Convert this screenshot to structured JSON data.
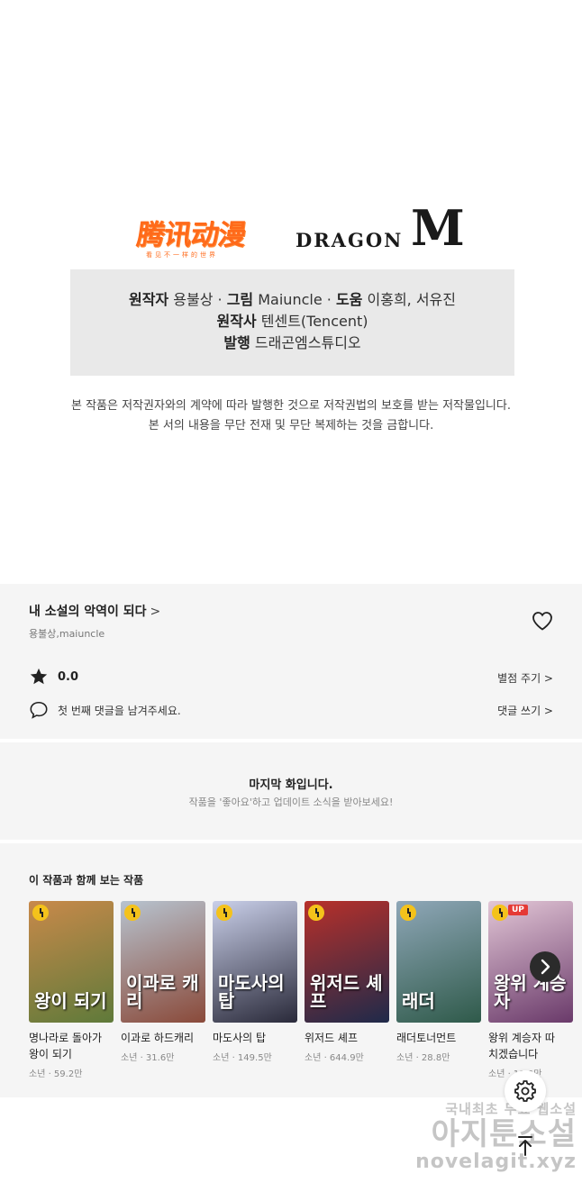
{
  "logos": {
    "tencent_name": "腾讯动漫",
    "tencent_tagline": "看见不一样的世界",
    "dragon_word": "DRAGON",
    "dragon_m": "M"
  },
  "credits": {
    "line1": [
      {
        "label": "원작자",
        "value": "용불상"
      },
      {
        "label": "그림",
        "value": "Maiuncle"
      },
      {
        "label": "도움",
        "value": "이홍희, 서유진"
      }
    ],
    "line2": {
      "label": "원작사",
      "value": "텐센트(Tencent)"
    },
    "line3": {
      "label": "발행",
      "value": "드래곤엠스튜디오"
    },
    "separator": "·"
  },
  "notice": {
    "line1": "본 작품은 저작권자와의 계약에 따라 발행한 것으로 저작권법의 보호를 받는 저작물입니다.",
    "line2": "본 서의 내용을 무단 전재 및 무단 복제하는 것을 금합니다."
  },
  "info": {
    "title": "내 소설의 악역이 되다",
    "title_chevron": ">",
    "authors": "용불상,maiuncle",
    "rating": "0.0",
    "rate_action": "별점 주기 >",
    "comment_prompt": "첫 번째 댓글을 남겨주세요.",
    "comment_action": "댓글 쓰기 >"
  },
  "last_episode": {
    "heading": "마지막 화입니다.",
    "sub": "작품을 '좋아요'하고 업데이트 소식을 받아보세요!"
  },
  "recommendations": {
    "section_title": "이 작품과 함께 보는 작품",
    "items": [
      {
        "name_l1": "명나라로 돌아가",
        "name_l2": "왕이 되기",
        "meta": "소년 · 59.2만",
        "badge": "",
        "cover_text": "왕이 되기",
        "color_a": "#c8894a",
        "color_b": "#5f7a3a"
      },
      {
        "name_l1": "이과로 하드캐리",
        "name_l2": "",
        "meta": "소년 · 31.6만",
        "badge": "",
        "cover_text": "이과로 캐리",
        "color_a": "#b7c3cf",
        "color_b": "#8a4a3a"
      },
      {
        "name_l1": "마도사의 탑",
        "name_l2": "",
        "meta": "소년 · 149.5만",
        "badge": "",
        "cover_text": "마도사의 탑",
        "color_a": "#c9cfe9",
        "color_b": "#2a2a3a"
      },
      {
        "name_l1": "위저드 셰프",
        "name_l2": "",
        "meta": "소년 · 644.9만",
        "badge": "",
        "cover_text": "위저드 셰프",
        "color_a": "#b8302a",
        "color_b": "#1f2a4a"
      },
      {
        "name_l1": "래더토너먼트",
        "name_l2": "",
        "meta": "소년 · 28.8만",
        "badge": "",
        "cover_text": "래더",
        "color_a": "#8fa7b8",
        "color_b": "#2f5a4a"
      },
      {
        "name_l1": "왕위 계승자 따",
        "name_l2": "치겠습니다",
        "meta": "소년 · 11.9만",
        "badge": "UP",
        "cover_text": "왕위 계승자",
        "color_a": "#e2c6d6",
        "color_b": "#6a3a6a"
      }
    ],
    "next_icon": "chevron-right-icon"
  },
  "watermark": {
    "line1": "국내최초 무료 웹소설",
    "line2": "아지툰소설",
    "line3": "novelagit.xyz"
  }
}
